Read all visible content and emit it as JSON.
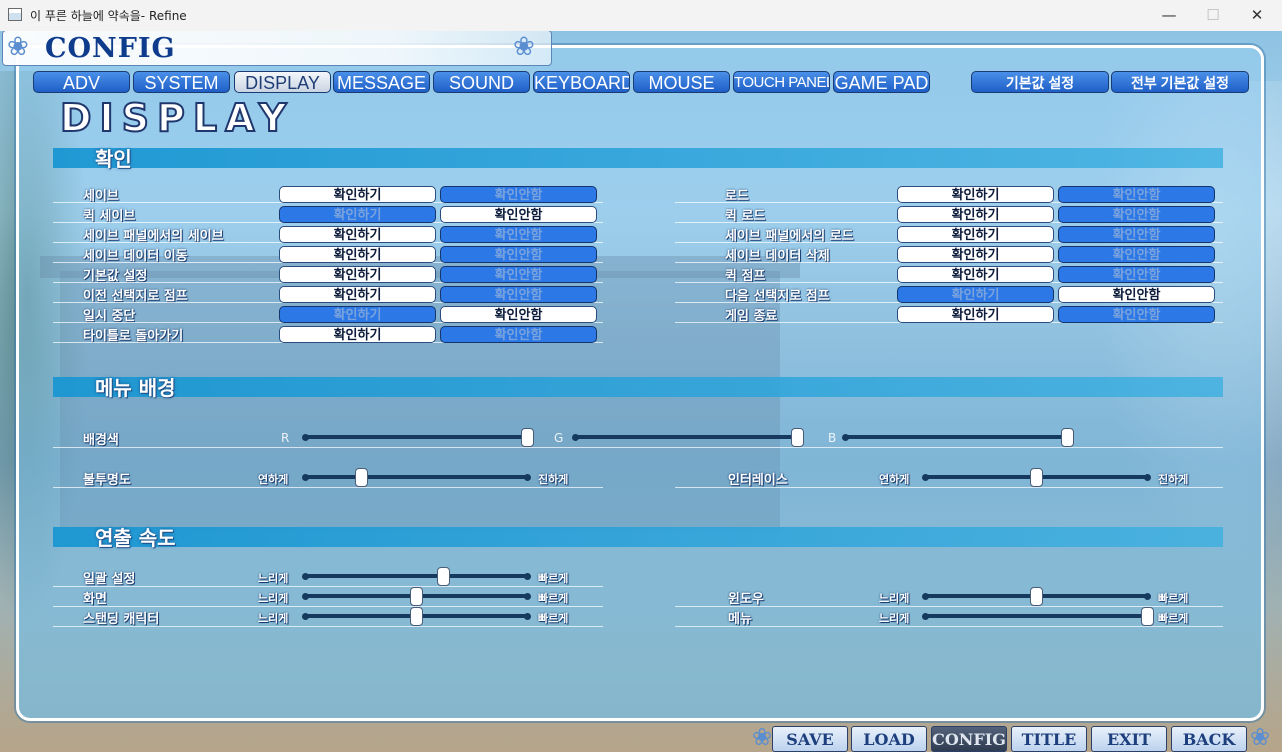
{
  "window": {
    "title": "이 푸른 하늘에 약속을- Refine",
    "controls": {
      "minimize": "—",
      "maximize": "☐",
      "close": "✕"
    }
  },
  "header": {
    "title": "CONFIG"
  },
  "tabs": [
    {
      "label": "ADV",
      "active": false
    },
    {
      "label": "SYSTEM",
      "active": false
    },
    {
      "label": "DISPLAY",
      "active": true
    },
    {
      "label": "MESSAGE",
      "active": false
    },
    {
      "label": "SOUND",
      "active": false
    },
    {
      "label": "KEYBOARD",
      "active": false
    },
    {
      "label": "MOUSE",
      "active": false
    },
    {
      "label": "TOUCH PANEL",
      "active": false
    },
    {
      "label": "GAME PAD",
      "active": false
    }
  ],
  "reset_buttons": {
    "default": "기본값 설정",
    "all_default": "전부 기본값 설정"
  },
  "page_title": "DISPLAY",
  "confirm_section": {
    "title": "확인",
    "yes_label": "확인하기",
    "no_label": "확인안함",
    "left": [
      {
        "label": "세이브",
        "selected": "yes"
      },
      {
        "label": "퀵 세이브",
        "selected": "no"
      },
      {
        "label": "세이브 패널에서의 세이브",
        "selected": "yes"
      },
      {
        "label": "세이브 데이터 이동",
        "selected": "yes"
      },
      {
        "label": "기본값 설정",
        "selected": "yes"
      },
      {
        "label": "이전 선택지로 점프",
        "selected": "yes"
      },
      {
        "label": "일시 중단",
        "selected": "no"
      },
      {
        "label": "타이틀로 돌아가기",
        "selected": "yes"
      }
    ],
    "right": [
      {
        "label": "로드",
        "selected": "yes"
      },
      {
        "label": "퀵 로드",
        "selected": "yes"
      },
      {
        "label": "세이브 패널에서의 로드",
        "selected": "yes"
      },
      {
        "label": "세이브 데이터 삭제",
        "selected": "yes"
      },
      {
        "label": "퀵 점프",
        "selected": "yes"
      },
      {
        "label": "다음 선택지로 점프",
        "selected": "no"
      },
      {
        "label": "게임 종료",
        "selected": "yes"
      }
    ]
  },
  "menu_bg_section": {
    "title": "메뉴 배경",
    "bg_color_label": "배경색",
    "r_label": "R",
    "g_label": "G",
    "b_label": "B",
    "r_value": 1.0,
    "g_value": 1.0,
    "b_value": 1.0,
    "opacity_label": "불투명도",
    "opacity_min": "연하게",
    "opacity_max": "진하게",
    "opacity_value": 0.25,
    "interlace_label": "인터레이스",
    "interlace_min": "연하게",
    "interlace_max": "진하게",
    "interlace_value": 0.5
  },
  "speed_section": {
    "title": "연출 속도",
    "slow": "느리게",
    "fast": "빠르게",
    "left": [
      {
        "label": "일괄 설정",
        "value": 0.62
      },
      {
        "label": "화면",
        "value": 0.5
      },
      {
        "label": "스탠딩 캐릭터",
        "value": 0.5
      }
    ],
    "right": [
      {
        "label": "윈도우",
        "value": 0.5
      },
      {
        "label": "메뉴",
        "value": 1.0
      }
    ]
  },
  "bottom_nav": [
    {
      "label": "SAVE",
      "active": false
    },
    {
      "label": "LOAD",
      "active": false
    },
    {
      "label": "CONFIG",
      "active": true
    },
    {
      "label": "TITLE",
      "active": false
    },
    {
      "label": "EXIT",
      "active": false
    },
    {
      "label": "BACK",
      "active": false
    }
  ],
  "colors": {
    "tab_blue": "#2c78e6",
    "section_bar": "#1a96d2",
    "header_text": "#0f3b8c"
  },
  "icons": {
    "flower": "flower-icon",
    "app": "app-icon"
  }
}
